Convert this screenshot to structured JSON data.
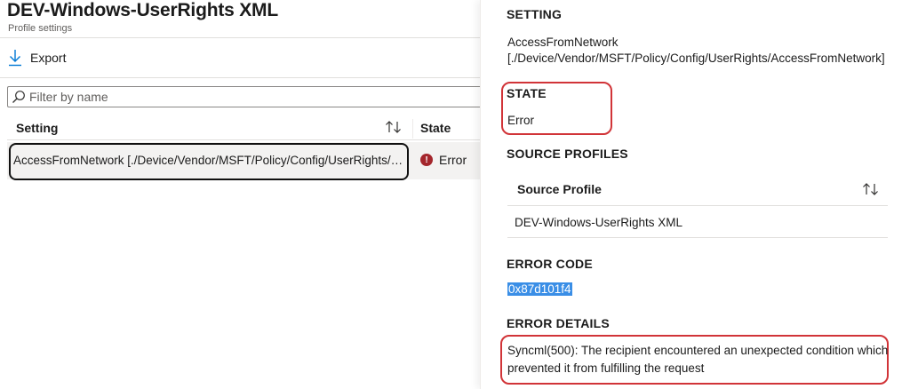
{
  "header": {
    "title": "DEV-Windows-UserRights XML",
    "subtitle": "Profile settings"
  },
  "toolbar": {
    "export_label": "Export"
  },
  "filter": {
    "placeholder": "Filter by name"
  },
  "table": {
    "columns": [
      "Setting",
      "State"
    ],
    "rows": [
      {
        "setting": "AccessFromNetwork [./Device/Vendor/MSFT/Policy/Config/UserRights/AccessFromNetwork]",
        "state": "Error"
      }
    ]
  },
  "detail": {
    "setting_heading": "SETTING",
    "setting_name": "AccessFromNetwork",
    "setting_path": "[./Device/Vendor/MSFT/Policy/Config/UserRights/AccessFromNetwork]",
    "state_heading": "STATE",
    "state_value": "Error",
    "source_profiles_heading": "SOURCE PROFILES",
    "source_profile_column": "Source Profile",
    "source_profiles": [
      "DEV-Windows-UserRights XML"
    ],
    "error_code_heading": "ERROR CODE",
    "error_code": "0x87d101f4",
    "error_details_heading": "ERROR DETAILS",
    "error_details": "Syncml(500): The recipient encountered an unexpected condition which prevented it from fulfilling the request"
  },
  "icons": {
    "export": "download-arrow-icon",
    "filter": "search-icon",
    "sort": "sort-arrows-icon",
    "error": "error-circle-icon"
  },
  "colors": {
    "accent": "#0078d4",
    "error": "#a4262c",
    "highlight_box": "#d13438",
    "selection": "#3a8ee6"
  }
}
